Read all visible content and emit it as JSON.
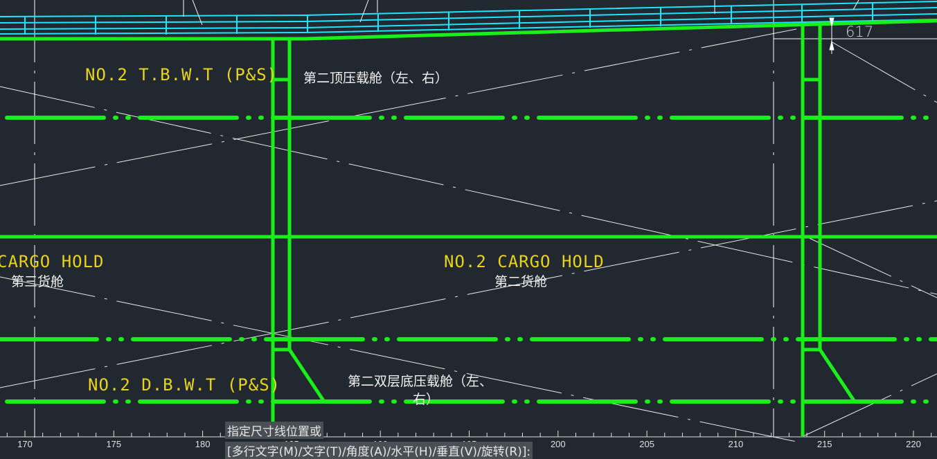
{
  "labels": {
    "tbwt_en": "NO.2  T.B.W.T (P&S)",
    "tbwt_cn": "第二顶压载舱（左、右）",
    "cargo3_en": "CARGO  HOLD",
    "cargo3_cn": "第三货舱",
    "cargo2_en": "NO.2  CARGO  HOLD",
    "cargo2_cn": "第二货舱",
    "dbwt_en": "NO.2  D.B.W.T (P&S)",
    "dbwt_cn_line1": "第二双层底压载舱（左、",
    "dbwt_cn_line2": "右）",
    "dimension": "617"
  },
  "ruler": {
    "ticks": [
      "170",
      "175",
      "180",
      "185",
      "190",
      "195",
      "200",
      "205",
      "210",
      "215",
      "220"
    ]
  },
  "command_line": {
    "prompt_line1": "指定尺寸线位置或",
    "prompt_line2": "[多行文字(M)/文字(T)/角度(A)/水平(H)/垂直(V)/旋转(R)]:"
  },
  "colors": {
    "background": "#212830",
    "structure_green": "#19f01a",
    "deck_cyan": "#19e6ff",
    "label_yellow": "#e8d418",
    "construction_white": "#ffffff"
  }
}
